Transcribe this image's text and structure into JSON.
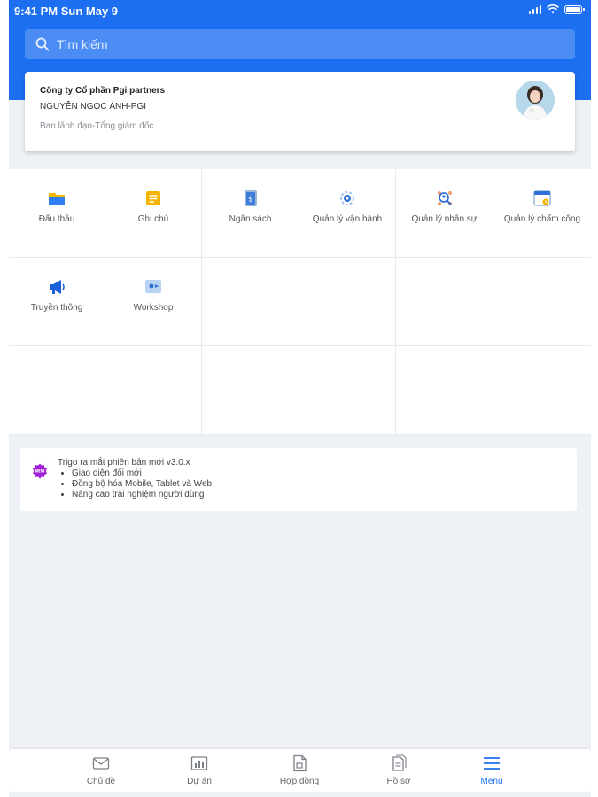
{
  "status_bar": {
    "time": "9:41 PM Sun May 9"
  },
  "search": {
    "placeholder": "Tìm kiếm"
  },
  "profile": {
    "company": "Công ty Cổ phần Pgi partners",
    "name": "NGUYỄN NGỌC ÁNH-PGI",
    "role": "Ban lãnh đạo-Tổng giám đốc"
  },
  "menu_items": [
    {
      "label": "Đấu thầu",
      "icon": "folder-icon"
    },
    {
      "label": "Ghi chú",
      "icon": "note-icon"
    },
    {
      "label": "Ngân sách",
      "icon": "budget-icon"
    },
    {
      "label": "Quản lý vận hành",
      "icon": "operations-icon"
    },
    {
      "label": "Quản lý nhân sự",
      "icon": "hr-icon"
    },
    {
      "label": "Quản lý chấm công",
      "icon": "calendar-icon"
    },
    {
      "label": "Truyền thông",
      "icon": "megaphone-icon"
    },
    {
      "label": "Workshop",
      "icon": "workshop-icon"
    }
  ],
  "notice": {
    "badge": "NEW",
    "title": "Trigo ra mắt phiên bản mới v3.0.x",
    "bullets": [
      "Giao diện đổi mới",
      "Đồng bộ hóa Mobile, Tablet và Web",
      "Nâng cao trải nghiệm người dùng"
    ]
  },
  "tabs": [
    {
      "label": "Chủ đề",
      "icon": "mail-icon"
    },
    {
      "label": "Dự án",
      "icon": "chart-icon"
    },
    {
      "label": "Hợp đồng",
      "icon": "contract-icon"
    },
    {
      "label": "Hồ sơ",
      "icon": "documents-icon"
    },
    {
      "label": "Menu",
      "icon": "menu-icon",
      "active": true
    }
  ],
  "colors": {
    "primary": "#1c6ff0",
    "search_bg": "#4c8df5",
    "badge": "#a020d8"
  }
}
